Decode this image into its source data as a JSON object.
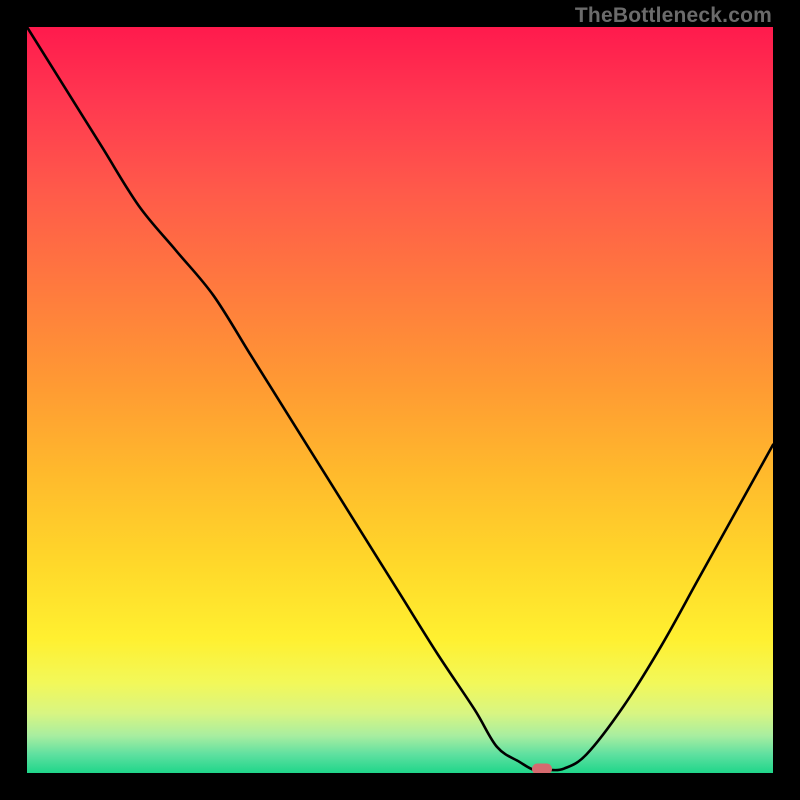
{
  "attribution": "TheBottleneck.com",
  "colors": {
    "background": "#000000",
    "attribution_text": "#6b6b6b",
    "curve_stroke": "#000000",
    "marker_fill": "#d66a6f"
  },
  "chart_data": {
    "type": "line",
    "title": "",
    "xlabel": "",
    "ylabel": "",
    "xlim": [
      0,
      100
    ],
    "ylim": [
      0,
      100
    ],
    "x": [
      0,
      5,
      10,
      15,
      20,
      25,
      30,
      35,
      40,
      45,
      50,
      55,
      60,
      63,
      66,
      68,
      70,
      72,
      75,
      80,
      85,
      90,
      95,
      100
    ],
    "values": [
      100,
      92,
      84,
      76,
      70,
      64,
      56,
      48,
      40,
      32,
      24,
      16,
      8.5,
      3.5,
      1.5,
      0.6,
      0.3,
      0.6,
      2.5,
      9,
      17,
      26,
      35,
      44
    ],
    "optimum_marker": {
      "x": 69,
      "y": 0.6
    },
    "flat_min_range": {
      "x_start": 67,
      "x_end": 71,
      "y": 0.4
    },
    "background_gradient_stops": [
      {
        "offset": 0.0,
        "color": "#ff1a4d"
      },
      {
        "offset": 0.1,
        "color": "#ff3850"
      },
      {
        "offset": 0.22,
        "color": "#ff5a4a"
      },
      {
        "offset": 0.35,
        "color": "#ff7a3e"
      },
      {
        "offset": 0.48,
        "color": "#ff9a33"
      },
      {
        "offset": 0.6,
        "color": "#ffba2c"
      },
      {
        "offset": 0.72,
        "color": "#ffd82a"
      },
      {
        "offset": 0.82,
        "color": "#fff030"
      },
      {
        "offset": 0.88,
        "color": "#f2f85a"
      },
      {
        "offset": 0.92,
        "color": "#d8f582"
      },
      {
        "offset": 0.95,
        "color": "#a8eea0"
      },
      {
        "offset": 0.975,
        "color": "#5fe0a0"
      },
      {
        "offset": 1.0,
        "color": "#1fd68a"
      }
    ]
  }
}
